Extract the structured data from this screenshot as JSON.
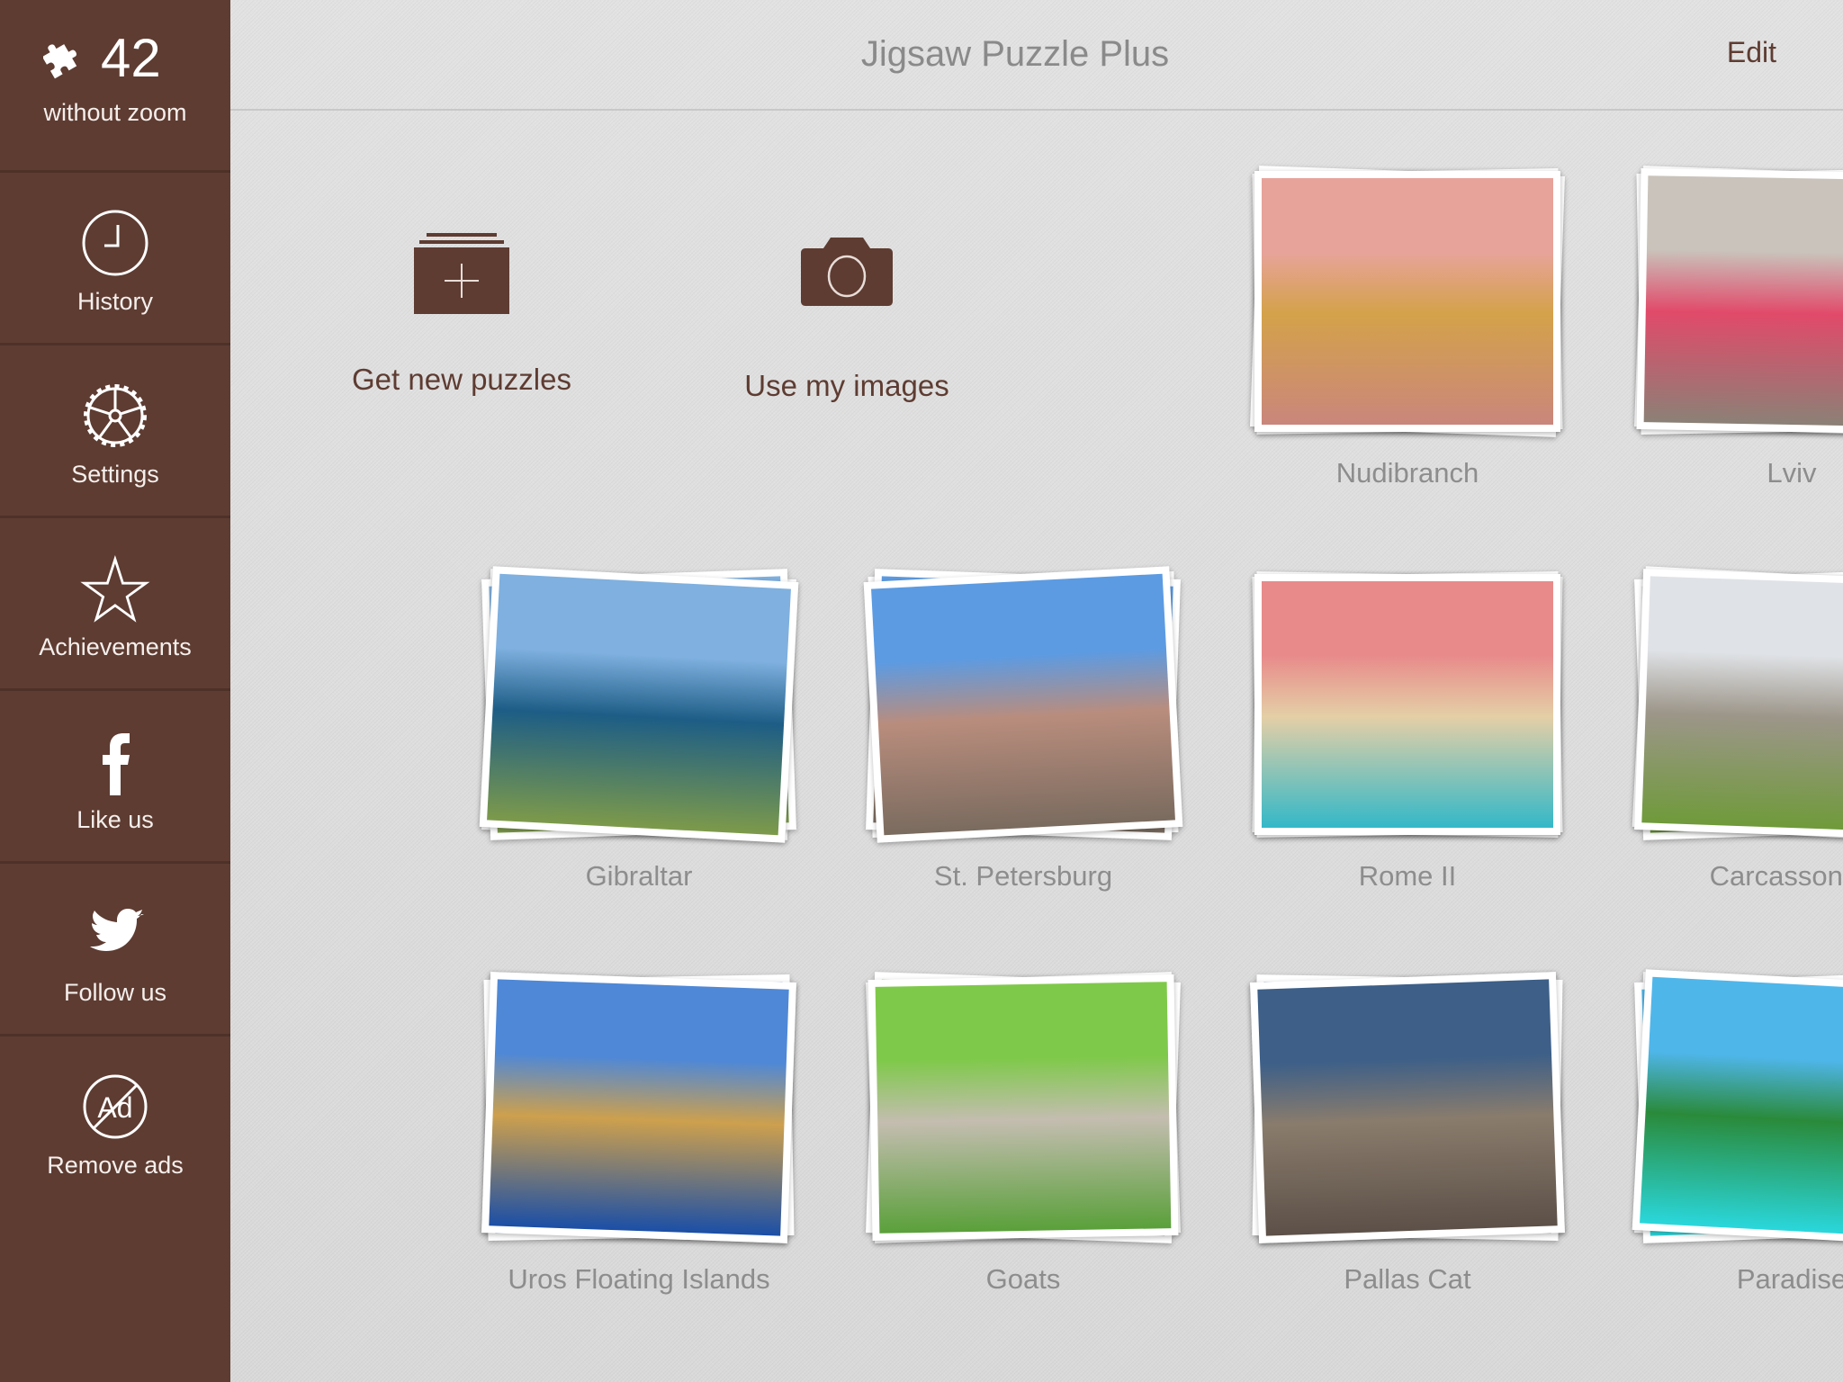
{
  "app": {
    "title": "Jigsaw Puzzle Plus",
    "edit_label": "Edit",
    "accent_color": "#5e3c32"
  },
  "sidebar": {
    "counter": {
      "icon": "puzzle-piece-icon",
      "value": "42",
      "label": "without zoom"
    },
    "items": [
      {
        "id": "history",
        "label": "History",
        "icon": "clock-icon"
      },
      {
        "id": "settings",
        "label": "Settings",
        "icon": "gear-icon"
      },
      {
        "id": "achievements",
        "label": "Achievements",
        "icon": "star-icon"
      },
      {
        "id": "like-us",
        "label": "Like us",
        "icon": "facebook-icon"
      },
      {
        "id": "follow-us",
        "label": "Follow us",
        "icon": "twitter-icon"
      },
      {
        "id": "remove-ads",
        "label": "Remove ads",
        "icon": "no-ads-icon",
        "icon_text": "Ad"
      }
    ]
  },
  "actions": [
    {
      "id": "get-new-puzzles",
      "label": "Get new puzzles",
      "icon": "add-stack-icon"
    },
    {
      "id": "use-my-images",
      "label": "Use my images",
      "icon": "camera-icon"
    }
  ],
  "puzzles": [
    {
      "name": "Nudibranch",
      "colors": [
        "#e7a39a",
        "#d4a24a",
        "#c9867c"
      ]
    },
    {
      "name": "Lviv",
      "colors": [
        "#c9c3bb",
        "#e14a6a",
        "#8b8176"
      ]
    },
    {
      "name": "Gibraltar",
      "colors": [
        "#7fb0df",
        "#1d5d86",
        "#7d9a4a"
      ]
    },
    {
      "name": "St. Petersburg",
      "colors": [
        "#5c9be2",
        "#b98d7d",
        "#7a6b5f"
      ]
    },
    {
      "name": "Rome II",
      "colors": [
        "#e88a8a",
        "#e4cfa6",
        "#33b8c8"
      ]
    },
    {
      "name": "Carcassonne",
      "colors": [
        "#dfe2e6",
        "#9d968a",
        "#6f9a3a"
      ]
    },
    {
      "name": "Uros Floating Islands",
      "colors": [
        "#4f88d6",
        "#cda04d",
        "#1b4fa6"
      ]
    },
    {
      "name": "Goats",
      "colors": [
        "#7fc94a",
        "#c4bdb0",
        "#5aa03a"
      ]
    },
    {
      "name": "Pallas Cat",
      "colors": [
        "#3d5f88",
        "#8a7c6c",
        "#5c5048"
      ]
    },
    {
      "name": "Paradise",
      "colors": [
        "#4fb6ea",
        "#2a8a3a",
        "#2ad7dc"
      ]
    }
  ]
}
